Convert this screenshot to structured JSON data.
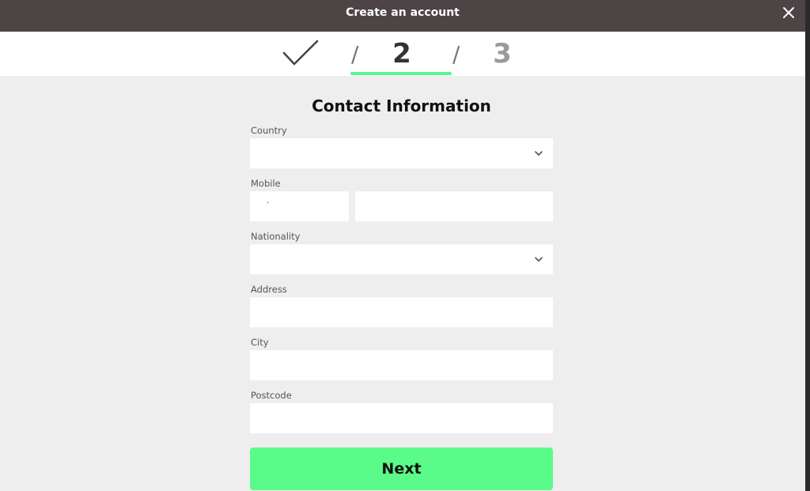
{
  "header": {
    "title": "Create an account",
    "close_icon": "close-icon"
  },
  "stepper": {
    "step1": {
      "state": "completed",
      "icon": "checkmark-icon"
    },
    "separator": "/",
    "step2": {
      "label": "2",
      "state": "active"
    },
    "step3": {
      "label": "3",
      "state": "inactive"
    },
    "active_color": "#5bf78a"
  },
  "form": {
    "title": "Contact Information",
    "country": {
      "label": "Country",
      "value": "",
      "icon": "chevron-down-icon"
    },
    "mobile": {
      "label": "Mobile",
      "code_value": "·",
      "number_value": ""
    },
    "nationality": {
      "label": "Nationality",
      "value": "",
      "icon": "chevron-down-icon"
    },
    "address": {
      "label": "Address",
      "value": ""
    },
    "city": {
      "label": "City",
      "value": ""
    },
    "postcode": {
      "label": "Postcode",
      "value": ""
    },
    "next_button": "Next"
  },
  "colors": {
    "header_bg": "#4d4446",
    "page_bg": "#eeeeee",
    "accent": "#5bfb8a"
  }
}
